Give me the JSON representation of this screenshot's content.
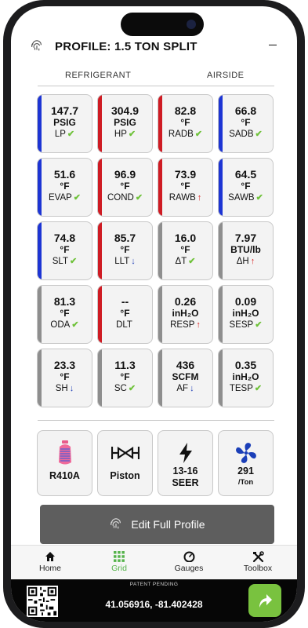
{
  "header": {
    "title": "PROFILE: 1.5 TON SPLIT"
  },
  "sections": {
    "left": "REFRIGERANT",
    "right": "AIRSIDE"
  },
  "colors": {
    "blue": "#1d35d4",
    "red": "#cf1b23",
    "gray": "#8e8e8e",
    "ok": "#6fc23a",
    "accent": "#56b34c"
  },
  "tiles": [
    {
      "value": "147.7",
      "unit": "PSIG",
      "label": "LP",
      "status": "ok",
      "bar": "blue"
    },
    {
      "value": "304.9",
      "unit": "PSIG",
      "label": "HP",
      "status": "ok",
      "bar": "red"
    },
    {
      "value": "82.8",
      "unit": "°F",
      "label": "RADB",
      "status": "ok",
      "bar": "red"
    },
    {
      "value": "66.8",
      "unit": "°F",
      "label": "SADB",
      "status": "ok",
      "bar": "blue"
    },
    {
      "value": "51.6",
      "unit": "°F",
      "label": "EVAP",
      "status": "ok",
      "bar": "blue"
    },
    {
      "value": "96.9",
      "unit": "°F",
      "label": "COND",
      "status": "ok",
      "bar": "red"
    },
    {
      "value": "73.9",
      "unit": "°F",
      "label": "RAWB",
      "status": "up",
      "bar": "red"
    },
    {
      "value": "64.5",
      "unit": "°F",
      "label": "SAWB",
      "status": "ok",
      "bar": "blue"
    },
    {
      "value": "74.8",
      "unit": "°F",
      "label": "SLT",
      "status": "ok",
      "bar": "blue"
    },
    {
      "value": "85.7",
      "unit": "°F",
      "label": "LLT",
      "status": "down",
      "bar": "red"
    },
    {
      "value": "16.0",
      "unit": "°F",
      "label": "ΔT",
      "status": "ok",
      "bar": "gray"
    },
    {
      "value": "7.97",
      "unit": "BTU/lb",
      "label": "ΔH",
      "status": "up",
      "bar": "gray"
    },
    {
      "value": "81.3",
      "unit": "°F",
      "label": "ODA",
      "status": "ok",
      "bar": "gray"
    },
    {
      "value": "--",
      "unit": "°F",
      "label": "DLT",
      "status": "",
      "bar": "red"
    },
    {
      "value": "0.26",
      "unit": "inH₂O",
      "label": "RESP",
      "status": "up",
      "bar": "gray"
    },
    {
      "value": "0.09",
      "unit": "inH₂O",
      "label": "SESP",
      "status": "ok",
      "bar": "gray"
    },
    {
      "value": "23.3",
      "unit": "°F",
      "label": "SH",
      "status": "down",
      "bar": "gray"
    },
    {
      "value": "11.3",
      "unit": "°F",
      "label": "SC",
      "status": "ok",
      "bar": "gray"
    },
    {
      "value": "436",
      "unit": "SCFM",
      "label": "AF",
      "status": "down",
      "bar": "gray"
    },
    {
      "value": "0.35",
      "unit": "inH₂O",
      "label": "TESP",
      "status": "ok",
      "bar": "gray"
    }
  ],
  "cards": {
    "refrigerant": {
      "label": "R410A",
      "icon": "refrigerant-cylinder-icon"
    },
    "metering": {
      "label": "Piston",
      "icon": "valve-icon"
    },
    "efficiency": {
      "label": "13-16",
      "sub": "SEER",
      "icon": "lightning-icon"
    },
    "airflow": {
      "label": "291",
      "sub": "/Ton",
      "icon": "fan-icon"
    }
  },
  "edit_button": {
    "label": "Edit Full Profile",
    "icon": "fingerprint-icon"
  },
  "tabs": [
    {
      "label": "Home",
      "icon": "home-icon"
    },
    {
      "label": "Grid",
      "icon": "grid-icon",
      "active": true
    },
    {
      "label": "Gauges",
      "icon": "gauge-icon"
    },
    {
      "label": "Toolbox",
      "icon": "toolbox-icon"
    }
  ],
  "footer": {
    "patent": "PATENT PENDING",
    "coordinates": "41.056916, -81.402428"
  }
}
